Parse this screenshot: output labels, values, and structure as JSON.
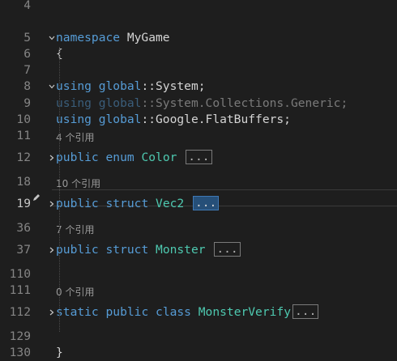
{
  "lines": [
    {
      "num": "4"
    },
    {
      "num": "5",
      "tokens": [
        {
          "t": "namespace",
          "c": "kw"
        },
        {
          "t": " MyGame"
        }
      ]
    },
    {
      "num": "6",
      "tokens": [
        {
          "t": "{"
        }
      ]
    },
    {
      "num": "7"
    },
    {
      "num": "8",
      "tokens": [
        {
          "t": "using",
          "c": "kw"
        },
        {
          "t": " "
        },
        {
          "t": "global",
          "c": "kw"
        },
        {
          "t": "::System;"
        }
      ]
    },
    {
      "num": "9",
      "tokens": [
        {
          "t": "using",
          "c": "kw dim"
        },
        {
          "t": " ",
          "c": "dim"
        },
        {
          "t": "global",
          "c": "kw dim"
        },
        {
          "t": "::System.Collections.Generic;",
          "c": "dim"
        }
      ]
    },
    {
      "num": "10",
      "tokens": [
        {
          "t": "using",
          "c": "kw"
        },
        {
          "t": " "
        },
        {
          "t": "global",
          "c": "kw"
        },
        {
          "t": "::Google.FlatBuffers;"
        }
      ]
    },
    {
      "num": "11"
    },
    {
      "num": "12",
      "lens": "4 个引用",
      "tokens": [
        {
          "t": "public",
          "c": "kw"
        },
        {
          "t": " "
        },
        {
          "t": "enum",
          "c": "kw"
        },
        {
          "t": " "
        },
        {
          "t": "Color",
          "c": "ty"
        },
        {
          "t": " "
        }
      ],
      "collapsed": "..."
    },
    {
      "num": "18"
    },
    {
      "num": "19",
      "lens": "10 个引用",
      "tokens": [
        {
          "t": "public",
          "c": "kw"
        },
        {
          "t": " "
        },
        {
          "t": "struct",
          "c": "kw"
        },
        {
          "t": " "
        },
        {
          "t": "Vec2",
          "c": "ty"
        },
        {
          "t": " "
        }
      ],
      "collapsed": "...",
      "selected": true
    },
    {
      "num": "36"
    },
    {
      "num": "37",
      "lens": "7 个引用",
      "tokens": [
        {
          "t": "public",
          "c": "kw"
        },
        {
          "t": " "
        },
        {
          "t": "struct",
          "c": "kw"
        },
        {
          "t": " "
        },
        {
          "t": "Monster",
          "c": "ty"
        },
        {
          "t": " "
        }
      ],
      "collapsed": "..."
    },
    {
      "num": "110"
    },
    {
      "num": "111"
    },
    {
      "num": "112",
      "lens": "0 个引用",
      "tokens": [
        {
          "t": "static",
          "c": "kw"
        },
        {
          "t": " "
        },
        {
          "t": "public",
          "c": "kw"
        },
        {
          "t": " "
        },
        {
          "t": "class",
          "c": "kw"
        },
        {
          "t": " "
        },
        {
          "t": "MonsterVerify",
          "c": "ty"
        }
      ],
      "collapsed": "..."
    },
    {
      "num": "129"
    },
    {
      "num": "130",
      "tokens": [
        {
          "t": "}"
        }
      ]
    }
  ],
  "colors": {
    "keyword": "#569cd6",
    "type": "#4ec9b0",
    "text": "#d4d4d4",
    "line_number": "#858585",
    "background": "#1e1e1e"
  }
}
